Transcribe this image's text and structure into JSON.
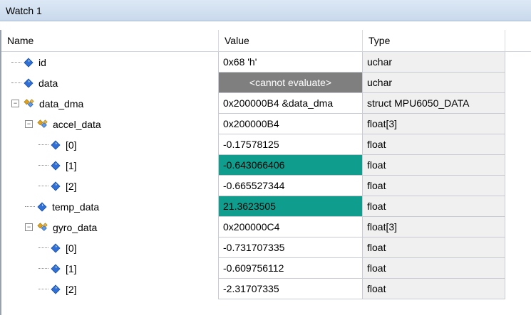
{
  "window": {
    "title": "Watch 1"
  },
  "columns": {
    "name": "Name",
    "value": "Value",
    "type": "Type"
  },
  "rows": [
    {
      "name": "id",
      "value": "0x68 'h'",
      "type": "uchar",
      "depth": 0,
      "kind": "leaf",
      "state": "normal"
    },
    {
      "name": "data",
      "value": "<cannot evaluate>",
      "type": "uchar",
      "depth": 0,
      "kind": "leaf",
      "state": "error"
    },
    {
      "name": "data_dma",
      "value": "0x200000B4 &data_dma",
      "type": "struct MPU6050_DATA",
      "depth": 0,
      "kind": "struct",
      "state": "normal"
    },
    {
      "name": "accel_data",
      "value": "0x200000B4",
      "type": "float[3]",
      "depth": 1,
      "kind": "struct",
      "state": "normal"
    },
    {
      "name": "[0]",
      "value": "-0.17578125",
      "type": "float",
      "depth": 2,
      "kind": "leaf",
      "state": "normal"
    },
    {
      "name": "[1]",
      "value": "-0.643066406",
      "type": "float",
      "depth": 2,
      "kind": "leaf",
      "state": "changed"
    },
    {
      "name": "[2]",
      "value": "-0.665527344",
      "type": "float",
      "depth": 2,
      "kind": "leaf",
      "state": "normal"
    },
    {
      "name": "temp_data",
      "value": "21.3623505",
      "type": "float",
      "depth": 1,
      "kind": "leaf",
      "state": "changed"
    },
    {
      "name": "gyro_data",
      "value": "0x200000C4",
      "type": "float[3]",
      "depth": 1,
      "kind": "struct",
      "state": "normal"
    },
    {
      "name": "[0]",
      "value": "-0.731707335",
      "type": "float",
      "depth": 2,
      "kind": "leaf",
      "state": "normal"
    },
    {
      "name": "[1]",
      "value": "-0.609756112",
      "type": "float",
      "depth": 2,
      "kind": "leaf",
      "state": "normal"
    },
    {
      "name": "[2]",
      "value": "-2.31707335",
      "type": "float",
      "depth": 2,
      "kind": "leaf",
      "state": "normal"
    }
  ],
  "icons": {
    "leaf": "variable-diamond-icon",
    "struct": "struct-members-icon",
    "expanded": "collapse-minus-icon"
  },
  "colors": {
    "changed": "#0f9e8e",
    "error": "#7f7f7f",
    "leaf_icon": "#2f6fd6",
    "struct_icon": "#e0a31c"
  }
}
